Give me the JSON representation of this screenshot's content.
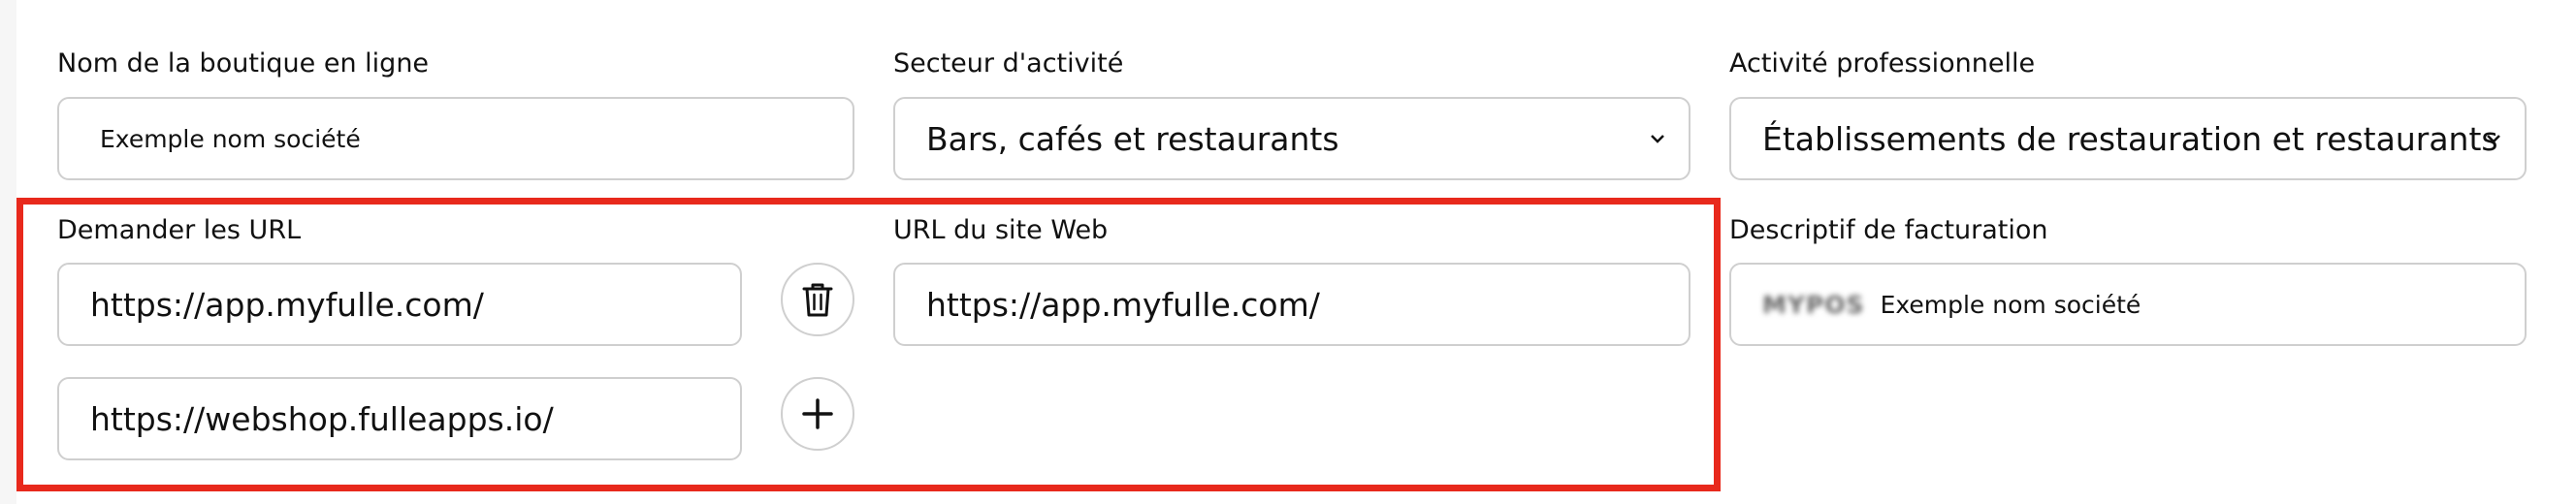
{
  "form": {
    "shop_name": {
      "label": "Nom de la boutique en ligne",
      "value": "Exemple nom société"
    },
    "sector": {
      "label": "Secteur d'activité",
      "value": "Bars, cafés et restaurants"
    },
    "activity": {
      "label": "Activité professionnelle",
      "value": "Établissements de restauration et restaurants"
    },
    "request_urls": {
      "label": "Demander les URL",
      "urls": [
        "https://app.myfulle.com/",
        "https://webshop.fulleapps.io/"
      ]
    },
    "website_url": {
      "label": "URL du site Web",
      "value": "https://app.myfulle.com/"
    },
    "billing_descriptor": {
      "label": "Descriptif de facturation",
      "prefix": "MYPOS",
      "value": "Exemple nom société"
    }
  },
  "colors": {
    "highlight": "#e8291c",
    "border": "#cfcfcf"
  },
  "icons": {
    "select": "chevron-down-icon",
    "remove": "trash-icon",
    "add": "plus-icon"
  }
}
